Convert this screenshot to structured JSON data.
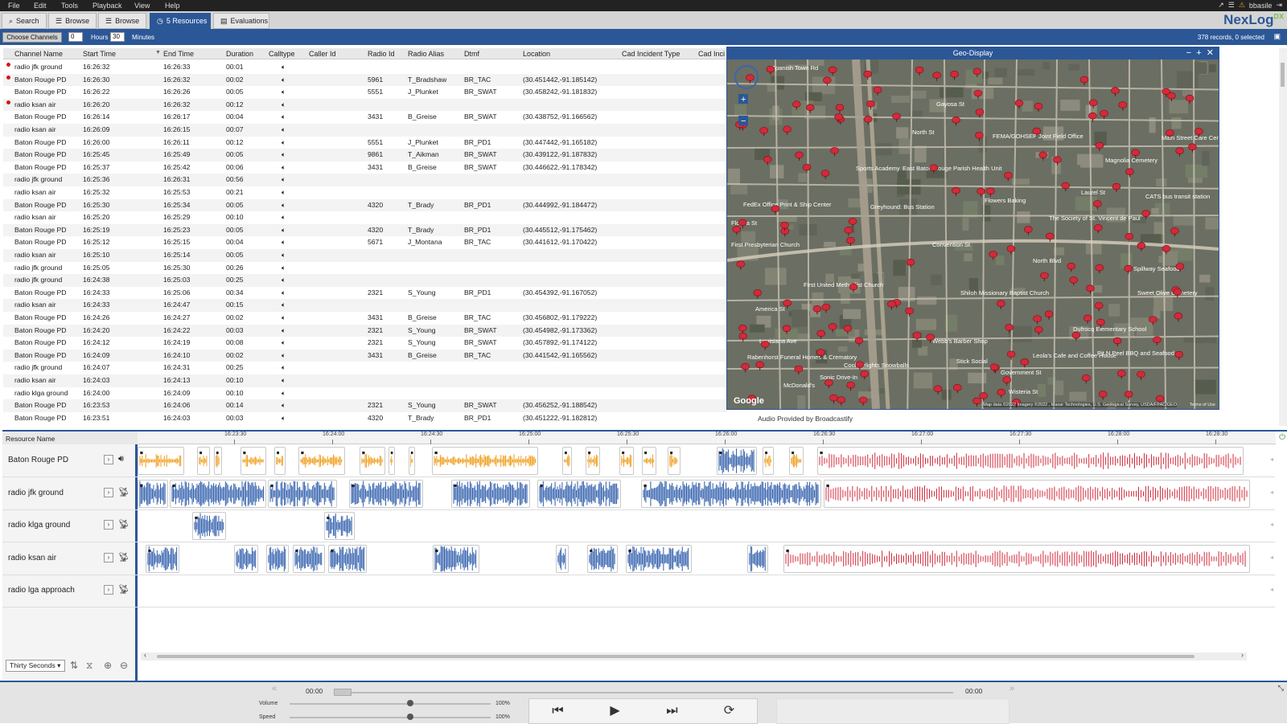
{
  "menu": [
    "File",
    "Edit",
    "Tools",
    "Playback",
    "View",
    "Help"
  ],
  "user": "bbasile",
  "tabs": [
    {
      "label": "Search",
      "icon": "search-icon"
    },
    {
      "label": "Browse",
      "icon": "list-icon"
    },
    {
      "label": "Browse",
      "icon": "list-icon"
    },
    {
      "label": "5 Resources",
      "icon": "clock-icon"
    },
    {
      "label": "Evaluations",
      "icon": "clipboard-icon"
    }
  ],
  "logo": {
    "name": "NexLog",
    "suffix": "DX"
  },
  "toolbar": {
    "choose_label": "Choose Channels",
    "hours_value": "0",
    "hours_label": "Hours",
    "minutes_value": "30",
    "minutes_label": "Minutes",
    "records": "378 records, 0 selected"
  },
  "columns": [
    "Channel Name",
    "Start Time",
    "End Time",
    "Duration",
    "Calltype",
    "Caller Id",
    "Radio Id",
    "Radio Alias",
    "Dtmf",
    "Location",
    "Cad Incident Type",
    "Cad Inci"
  ],
  "rows": [
    {
      "ch": "radio jfk ground",
      "start": "16:26:32",
      "end": "16:26:33",
      "dur": "00:01",
      "rid": "",
      "alias": "",
      "dtmf": "",
      "loc": "",
      "dot": true
    },
    {
      "ch": "Baton Rouge PD",
      "start": "16:26:30",
      "end": "16:26:32",
      "dur": "00:02",
      "rid": "5961",
      "alias": "T_Bradshaw",
      "dtmf": "BR_TAC",
      "loc": "(30.451442,-91.185142)",
      "dot": true
    },
    {
      "ch": "Baton Rouge PD",
      "start": "16:26:22",
      "end": "16:26:26",
      "dur": "00:05",
      "rid": "5551",
      "alias": "J_Plunket",
      "dtmf": "BR_SWAT",
      "loc": "(30.458242,-91.181832)",
      "dot": false
    },
    {
      "ch": "radio ksan air",
      "start": "16:26:20",
      "end": "16:26:32",
      "dur": "00:12",
      "rid": "",
      "alias": "",
      "dtmf": "",
      "loc": "",
      "dot": true
    },
    {
      "ch": "Baton Rouge PD",
      "start": "16:26:14",
      "end": "16:26:17",
      "dur": "00:04",
      "rid": "3431",
      "alias": "B_Greise",
      "dtmf": "BR_SWAT",
      "loc": "(30.438752,-91.166562)",
      "dot": false
    },
    {
      "ch": "radio ksan air",
      "start": "16:26:09",
      "end": "16:26:15",
      "dur": "00:07",
      "rid": "",
      "alias": "",
      "dtmf": "",
      "loc": "",
      "dot": false
    },
    {
      "ch": "Baton Rouge PD",
      "start": "16:26:00",
      "end": "16:26:11",
      "dur": "00:12",
      "rid": "5551",
      "alias": "J_Plunket",
      "dtmf": "BR_PD1",
      "loc": "(30.447442,-91.165182)",
      "dot": false
    },
    {
      "ch": "Baton Rouge PD",
      "start": "16:25:45",
      "end": "16:25:49",
      "dur": "00:05",
      "rid": "9861",
      "alias": "T_Aikman",
      "dtmf": "BR_SWAT",
      "loc": "(30.439122,-91.187832)",
      "dot": false
    },
    {
      "ch": "Baton Rouge PD",
      "start": "16:25:37",
      "end": "16:25:42",
      "dur": "00:06",
      "rid": "3431",
      "alias": "B_Greise",
      "dtmf": "BR_SWAT",
      "loc": "(30.446622,-91.178342)",
      "dot": false
    },
    {
      "ch": "radio jfk ground",
      "start": "16:25:36",
      "end": "16:26:31",
      "dur": "00:56",
      "rid": "",
      "alias": "",
      "dtmf": "",
      "loc": "",
      "dot": false
    },
    {
      "ch": "radio ksan air",
      "start": "16:25:32",
      "end": "16:25:53",
      "dur": "00:21",
      "rid": "",
      "alias": "",
      "dtmf": "",
      "loc": "",
      "dot": false
    },
    {
      "ch": "Baton Rouge PD",
      "start": "16:25:30",
      "end": "16:25:34",
      "dur": "00:05",
      "rid": "4320",
      "alias": "T_Brady",
      "dtmf": "BR_PD1",
      "loc": "(30.444992,-91.184472)",
      "dot": false
    },
    {
      "ch": "radio ksan air",
      "start": "16:25:20",
      "end": "16:25:29",
      "dur": "00:10",
      "rid": "",
      "alias": "",
      "dtmf": "",
      "loc": "",
      "dot": false
    },
    {
      "ch": "Baton Rouge PD",
      "start": "16:25:19",
      "end": "16:25:23",
      "dur": "00:05",
      "rid": "4320",
      "alias": "T_Brady",
      "dtmf": "BR_PD1",
      "loc": "(30.445512,-91.175462)",
      "dot": false
    },
    {
      "ch": "Baton Rouge PD",
      "start": "16:25:12",
      "end": "16:25:15",
      "dur": "00:04",
      "rid": "5671",
      "alias": "J_Montana",
      "dtmf": "BR_TAC",
      "loc": "(30.441612,-91.170422)",
      "dot": false
    },
    {
      "ch": "radio ksan air",
      "start": "16:25:10",
      "end": "16:25:14",
      "dur": "00:05",
      "rid": "",
      "alias": "",
      "dtmf": "",
      "loc": "",
      "dot": false
    },
    {
      "ch": "radio jfk ground",
      "start": "16:25:05",
      "end": "16:25:30",
      "dur": "00:26",
      "rid": "",
      "alias": "",
      "dtmf": "",
      "loc": "",
      "dot": false
    },
    {
      "ch": "radio jfk ground",
      "start": "16:24:38",
      "end": "16:25:03",
      "dur": "00:25",
      "rid": "",
      "alias": "",
      "dtmf": "",
      "loc": "",
      "dot": false
    },
    {
      "ch": "Baton Rouge PD",
      "start": "16:24:33",
      "end": "16:25:06",
      "dur": "00:34",
      "rid": "2321",
      "alias": "S_Young",
      "dtmf": "BR_PD1",
      "loc": "(30.454392,-91.167052)",
      "dot": false
    },
    {
      "ch": "radio ksan air",
      "start": "16:24:33",
      "end": "16:24:47",
      "dur": "00:15",
      "rid": "",
      "alias": "",
      "dtmf": "",
      "loc": "",
      "dot": false
    },
    {
      "ch": "Baton Rouge PD",
      "start": "16:24:26",
      "end": "16:24:27",
      "dur": "00:02",
      "rid": "3431",
      "alias": "B_Greise",
      "dtmf": "BR_TAC",
      "loc": "(30.456802,-91.179222)",
      "dot": false
    },
    {
      "ch": "Baton Rouge PD",
      "start": "16:24:20",
      "end": "16:24:22",
      "dur": "00:03",
      "rid": "2321",
      "alias": "S_Young",
      "dtmf": "BR_SWAT",
      "loc": "(30.454982,-91.173362)",
      "dot": false
    },
    {
      "ch": "Baton Rouge PD",
      "start": "16:24:12",
      "end": "16:24:19",
      "dur": "00:08",
      "rid": "2321",
      "alias": "S_Young",
      "dtmf": "BR_SWAT",
      "loc": "(30.457892,-91.174122)",
      "dot": false
    },
    {
      "ch": "Baton Rouge PD",
      "start": "16:24:09",
      "end": "16:24:10",
      "dur": "00:02",
      "rid": "3431",
      "alias": "B_Greise",
      "dtmf": "BR_TAC",
      "loc": "(30.441542,-91.165562)",
      "dot": false
    },
    {
      "ch": "radio jfk ground",
      "start": "16:24:07",
      "end": "16:24:31",
      "dur": "00:25",
      "rid": "",
      "alias": "",
      "dtmf": "",
      "loc": "",
      "dot": false
    },
    {
      "ch": "radio ksan air",
      "start": "16:24:03",
      "end": "16:24:13",
      "dur": "00:10",
      "rid": "",
      "alias": "",
      "dtmf": "",
      "loc": "",
      "dot": false
    },
    {
      "ch": "radio klga ground",
      "start": "16:24:00",
      "end": "16:24:09",
      "dur": "00:10",
      "rid": "",
      "alias": "",
      "dtmf": "",
      "loc": "",
      "dot": false
    },
    {
      "ch": "Baton Rouge PD",
      "start": "16:23:53",
      "end": "16:24:06",
      "dur": "00:14",
      "rid": "2321",
      "alias": "S_Young",
      "dtmf": "BR_SWAT",
      "loc": "(30.456252,-91.188542)",
      "dot": false
    },
    {
      "ch": "Baton Rouge PD",
      "start": "16:23:51",
      "end": "16:24:03",
      "dur": "00:03",
      "rid": "4320",
      "alias": "T_Brady",
      "dtmf": "BR_PD1",
      "loc": "(30.451222,-91.182812)",
      "dot": false
    }
  ],
  "geo": {
    "title": "Geo-Display",
    "footer": "Audio Provided by Broadcastify",
    "google": "Google",
    "attribution": "Map data ©2022 Imagery ©2022 , Maxar Technologies, U.S. Geological Survey, USDA/FPAC/GEO",
    "terms": "Terms of Use",
    "labels": [
      "Spanish Town Rd",
      "FEMA/GOHSEP Joint Field Office",
      "Magnolia Cemetery",
      "Main Street Care Center",
      "East Baton Rouge Parish Health Unit",
      "Greyhound: Bus Station",
      "Flowers Baking",
      "CATS bus transit station",
      "FedEx Office Print & Ship Center",
      "The Society of St. Vincent de Paul",
      "First Presbyterian Church",
      "Convention St",
      "North Blvd",
      "First United Methodist Church",
      "Shiloh Missionary Baptist Church",
      "Spillway Seafood",
      "Sweet Olive Cemetery",
      "America St",
      "Louisiana Ave",
      "Webb's Barber Shop",
      "Dufrocq Elementary School",
      "Rabenhorst Funeral Homes & Crematory",
      "Cool Delights Snowballs",
      "Stick Social",
      "Leola's Cafe and Coffee House",
      "Pit N Peel BBQ and Seafood",
      "Sonic Drive-In",
      "McDonald's",
      "Government St",
      "Wisteria St",
      "Laurel St",
      "North St",
      "Gayosa St",
      "Florida St",
      "Sports Academy"
    ]
  },
  "timeline": {
    "header": "Resource Name",
    "ticks": [
      "16:23:30",
      "16:24:00",
      "16:24:30",
      "16:25:00",
      "16:25:30",
      "16:26:00",
      "16:26:30",
      "16:27:00",
      "16:27:30",
      "16:28:00",
      "16:28:30"
    ],
    "lanes": [
      {
        "name": "Baton Rouge PD",
        "icon": "speaker-icon"
      },
      {
        "name": "radio jfk ground",
        "icon": "radio-antenna-icon"
      },
      {
        "name": "radio klga ground",
        "icon": "radio-antenna-icon"
      },
      {
        "name": "radio ksan air",
        "icon": "radio-antenna-icon"
      },
      {
        "name": "radio lga approach",
        "icon": "radio-antenna-icon"
      }
    ],
    "zoom": "Thirty Seconds"
  },
  "player": {
    "time_left": "00:00",
    "time_right": "00:00",
    "volume_label": "Volume",
    "volume_value": "100%",
    "speed_label": "Speed",
    "speed_value": "100%",
    "volume_level": 0.6,
    "speed_level": 0.6
  },
  "colors": {
    "accent": "#2b5797",
    "orange": "#f0a020",
    "blue": "#3a66b0",
    "red": "#d22a3a"
  }
}
